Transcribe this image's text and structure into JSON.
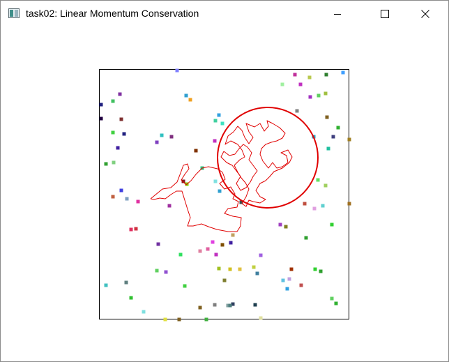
{
  "window": {
    "title": "task02: Linear Momentum Conservation",
    "controls": {
      "minimize_icon": "minimize-icon",
      "maximize_icon": "maximize-icon",
      "close_icon": "close-icon"
    }
  },
  "simulation": {
    "big_ball_color": "#e00000",
    "trail_color": "#e00000",
    "border_color": "#000000",
    "particle_count": 90
  }
}
